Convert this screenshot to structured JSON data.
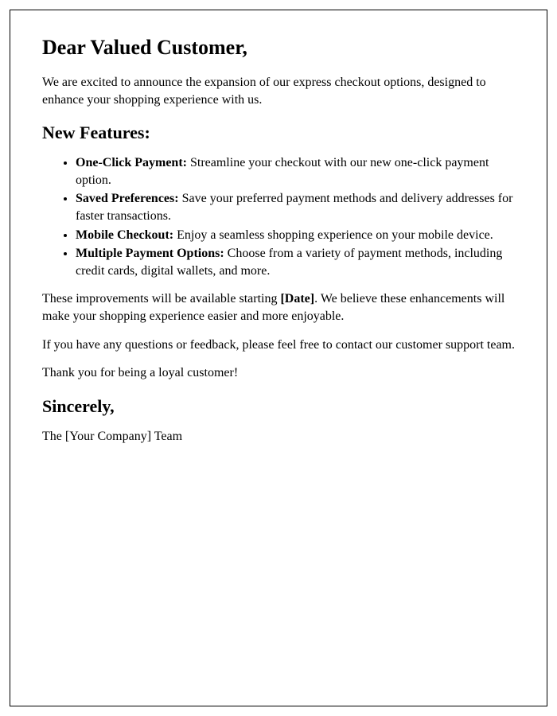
{
  "greeting": "Dear Valued Customer,",
  "intro": "We are excited to announce the expansion of our express checkout options, designed to enhance your shopping experience with us.",
  "features_heading": "New Features:",
  "features": [
    {
      "title": "One-Click Payment:",
      "desc": " Streamline your checkout with our new one-click payment option."
    },
    {
      "title": "Saved Preferences:",
      "desc": " Save your preferred payment methods and delivery addresses for faster transactions."
    },
    {
      "title": "Mobile Checkout:",
      "desc": " Enjoy a seamless shopping experience on your mobile device."
    },
    {
      "title": "Multiple Payment Options:",
      "desc": " Choose from a variety of payment methods, including credit cards, digital wallets, and more."
    }
  ],
  "availability_pre": "These improvements will be available starting ",
  "availability_date": "[Date]",
  "availability_post": ". We believe these enhancements will make your shopping experience easier and more enjoyable.",
  "feedback": "If you have any questions or feedback, please feel free to contact our customer support team.",
  "thanks": "Thank you for being a loyal customer!",
  "signoff": "Sincerely,",
  "team": "The [Your Company] Team"
}
